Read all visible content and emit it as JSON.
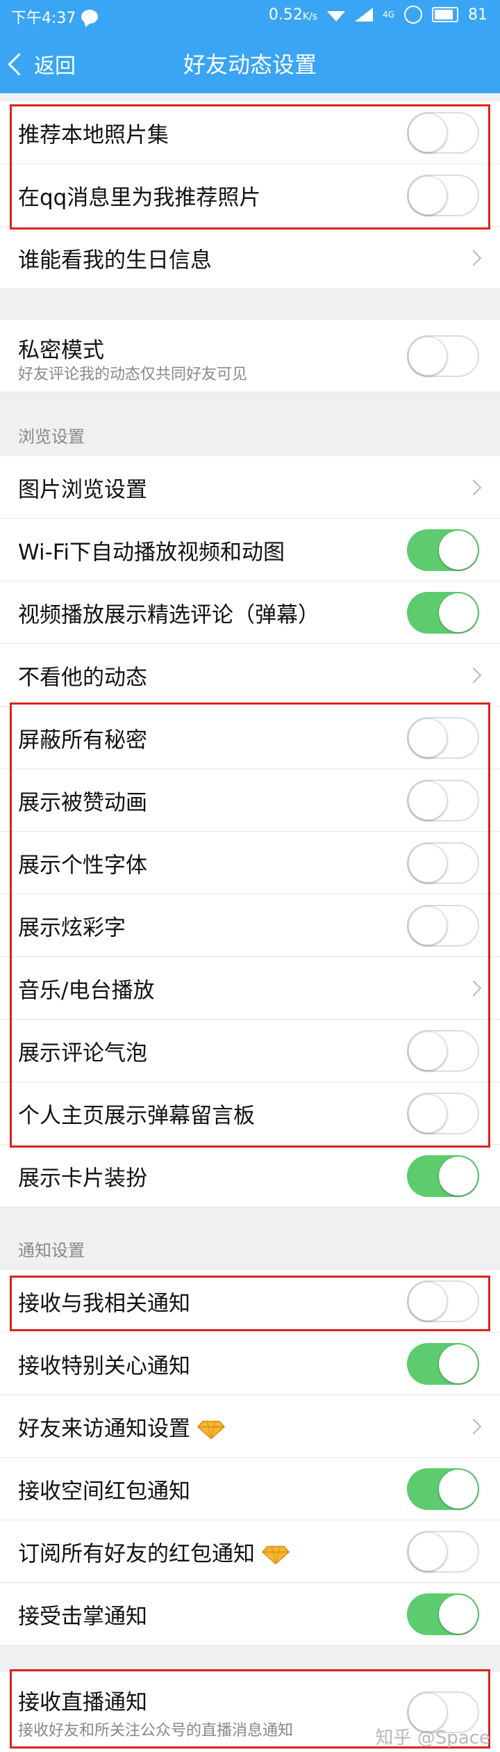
{
  "status": {
    "time": "下午4:37",
    "speed": "0.52",
    "speed_unit": "K/s",
    "network": "4G",
    "battery": "81"
  },
  "nav": {
    "back": "返回",
    "title": "好友动态设置"
  },
  "group1": [
    {
      "label": "推荐本地照片集",
      "control": "off"
    },
    {
      "label": "在qq消息里为我推荐照片",
      "control": "off"
    },
    {
      "label": "谁能看我的生日信息",
      "control": "arrow"
    }
  ],
  "privacy": {
    "label": "私密模式",
    "sub": "好友评论我的动态仅共同好友可见",
    "control": "off"
  },
  "browse": {
    "header": "浏览设置",
    "items": [
      {
        "label": "图片浏览设置",
        "control": "arrow"
      },
      {
        "label": "Wi-Fi下自动播放视频和动图",
        "control": "on"
      },
      {
        "label": "视频播放展示精选评论（弹幕）",
        "control": "on"
      },
      {
        "label": "不看他的动态",
        "control": "arrow"
      },
      {
        "label": "屏蔽所有秘密",
        "control": "off"
      },
      {
        "label": "展示被赞动画",
        "control": "off"
      },
      {
        "label": "展示个性字体",
        "control": "off"
      },
      {
        "label": "展示炫彩字",
        "control": "off"
      },
      {
        "label": "音乐/电台播放",
        "control": "arrow"
      },
      {
        "label": "展示评论气泡",
        "control": "off"
      },
      {
        "label": "个人主页展示弹幕留言板",
        "control": "off"
      },
      {
        "label": "展示卡片装扮",
        "control": "on"
      }
    ]
  },
  "notify": {
    "header": "通知设置",
    "items": [
      {
        "label": "接收与我相关通知",
        "control": "off"
      },
      {
        "label": "接收特别关心通知",
        "control": "on"
      },
      {
        "label": "好友来访通知设置",
        "control": "arrow",
        "icon": "diamond-icon"
      },
      {
        "label": "接收空间红包通知",
        "control": "on"
      },
      {
        "label": "订阅所有好友的红包通知",
        "control": "off",
        "icon": "diamond-icon"
      },
      {
        "label": "接受击掌通知",
        "control": "on"
      }
    ]
  },
  "live": {
    "label": "接收直播通知",
    "sub": "接收好友和所关注公众号的直播消息通知",
    "control": "off"
  },
  "watermark": "知乎 @Space",
  "colors": {
    "accent": "#3aa5f5",
    "toggle_on": "#5ccc6e",
    "highlight": "#d9241d"
  }
}
